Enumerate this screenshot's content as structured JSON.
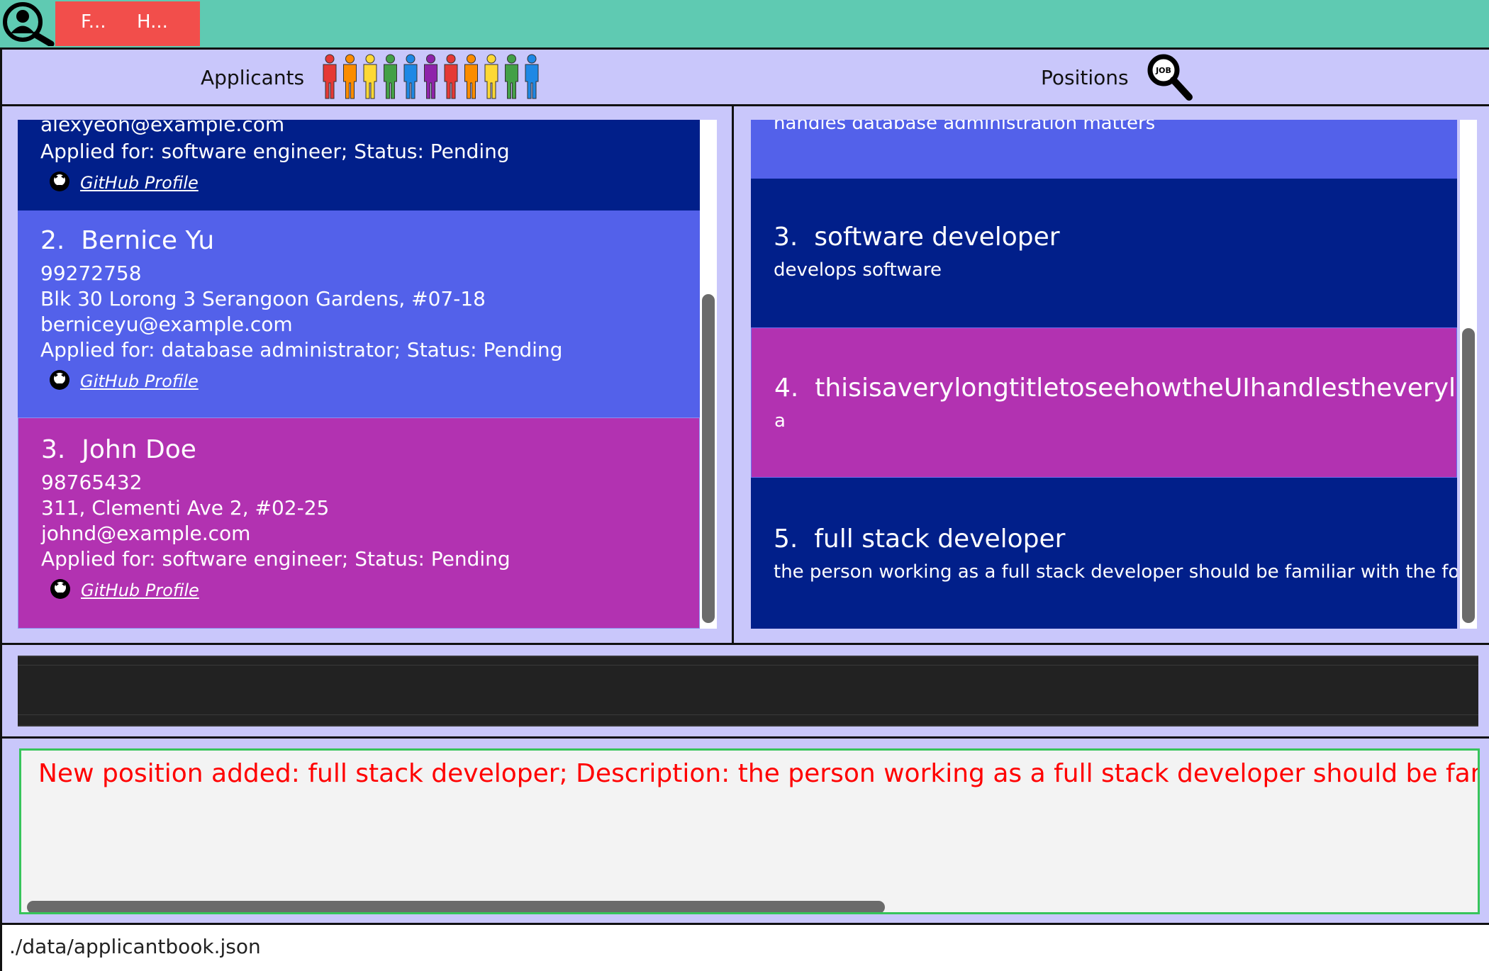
{
  "menu": {
    "file_label": "F...",
    "help_label": "H..."
  },
  "header": {
    "applicants_label": "Applicants",
    "positions_label": "Positions",
    "job_icon_text": "JOB"
  },
  "applicants": [
    {
      "email": "alexyeoh@example.com",
      "applied": "Applied for: software engineer; Status: Pending",
      "github": "GitHub Profile"
    },
    {
      "index": "2.",
      "name": "Bernice Yu",
      "phone": "99272758",
      "address": "Blk 30 Lorong 3 Serangoon Gardens, #07-18",
      "email": "berniceyu@example.com",
      "applied": "Applied for: database administrator; Status: Pending",
      "github": "GitHub Profile"
    },
    {
      "index": "3.",
      "name": "John Doe",
      "phone": "98765432",
      "address": "311, Clementi Ave 2, #02-25",
      "email": "johnd@example.com",
      "applied": "Applied for: software engineer; Status: Pending",
      "github": "GitHub Profile"
    }
  ],
  "positions": [
    {
      "description": "handles database administration matters"
    },
    {
      "index": "3.",
      "title": "software developer",
      "description": "develops software"
    },
    {
      "index": "4.",
      "title": "thisisaverylongtitletoseehowtheUIhandlestheverylongn...",
      "description": "a"
    },
    {
      "index": "5.",
      "title": "full stack developer",
      "description": "the person working as a full stack developer should be familiar with the following..."
    }
  ],
  "command": {
    "value": ""
  },
  "result": {
    "message": "New position added: full stack developer; Description: the person working as a full stack developer should be familiar with the follow"
  },
  "status": {
    "file_path": "./data/applicantbook.json"
  },
  "colors": {
    "menubar": "#5fcab2",
    "menu_block": "#f24e4b",
    "background": "#c9c7fb",
    "card_navy": "#011f8a",
    "card_blue": "#5361ea",
    "card_purple": "#b232b1",
    "result_text": "#ff0000"
  }
}
